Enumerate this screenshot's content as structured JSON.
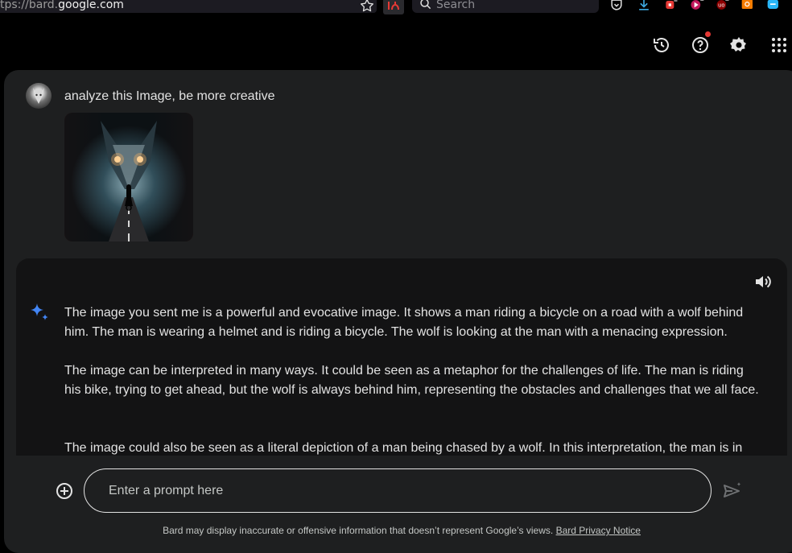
{
  "browser": {
    "url_scheme": "tps://bard.",
    "url_host": "google.com",
    "search_placeholder": "Search"
  },
  "header": {
    "icons": [
      "history-icon",
      "help-icon",
      "settings-icon",
      "apps-grid-icon"
    ]
  },
  "conversation": {
    "user_prompt": "analyze this Image, be more creative",
    "response_paragraphs": [
      "The image you sent me is a powerful and evocative image. It shows a man riding a bicycle on a road with a wolf behind him. The man is wearing a helmet and is riding a bicycle. The wolf is looking at the man with a menacing expression.",
      "The image can be interpreted in many ways. It could be seen as a metaphor for the challenges of life. The man is riding his bike, trying to get ahead, but the wolf is always behind him, representing the obstacles and challenges that we all face.",
      "The image could also be seen as a literal depiction of a man being chased by a wolf. In this interpretation, the man is in"
    ]
  },
  "input": {
    "placeholder": "Enter a prompt here"
  },
  "footer": {
    "disclaimer": "Bard may display inaccurate or offensive information that doesn’t represent Google’s views.",
    "privacy_link": "Bard Privacy Notice"
  },
  "colors": {
    "background": "#000000",
    "panel": "#1e1f20",
    "response_card": "#131314",
    "text": "#e3e3e3",
    "sparkle_blue": "#4285f4",
    "notification_red": "#e53935"
  }
}
